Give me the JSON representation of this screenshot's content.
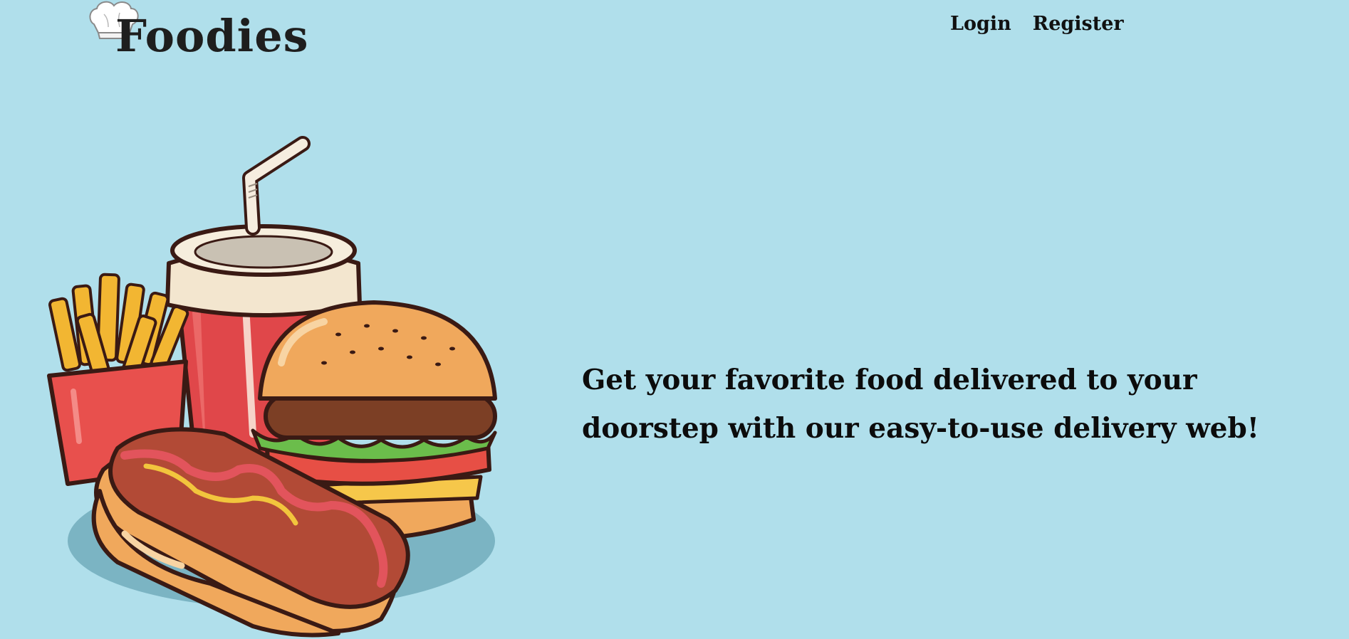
{
  "brand": {
    "name": "Foodies",
    "logo_icon": "chef-hat-icon"
  },
  "nav": {
    "login_label": "Login",
    "register_label": "Register"
  },
  "hero": {
    "tagline": "Get your favorite food delivered to your doorstep with our easy-to-use delivery web!",
    "illustration": "fast-food-illustration"
  },
  "colors": {
    "background": "#b0dfeb",
    "text": "#111111"
  }
}
